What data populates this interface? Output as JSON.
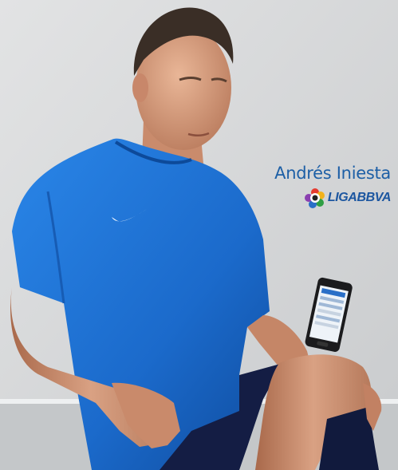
{
  "caption": {
    "player_name": "Andrés Iniesta",
    "league_name": "LIGABBVA"
  },
  "colors": {
    "background": "#d6d8d9",
    "jersey": "#1f6fd1",
    "shorts": "#141d44",
    "caption_text": "#1d5fa6"
  },
  "icons": [
    "nike-swoosh-icon",
    "liga-bbva-logo-icon",
    "smartphone-icon"
  ]
}
